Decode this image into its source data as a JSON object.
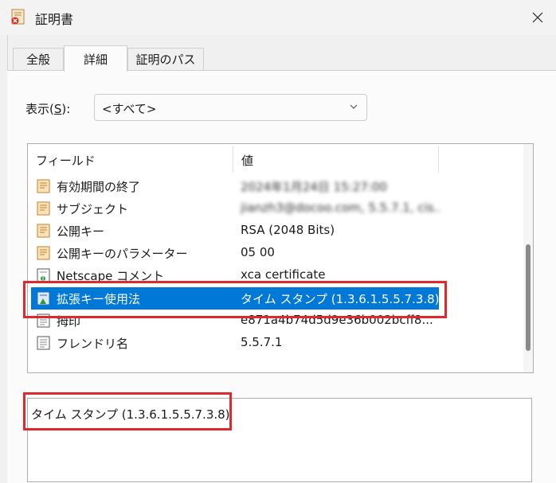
{
  "window": {
    "title": "証明書"
  },
  "tabs": [
    {
      "label": "全般"
    },
    {
      "label": "詳細"
    },
    {
      "label": "証明のパス"
    }
  ],
  "show": {
    "label_prefix": "表示(",
    "label_key": "S",
    "label_suffix": "):",
    "selected": "<すべて>"
  },
  "columns": {
    "field": "フィールド",
    "value": "値"
  },
  "rows": [
    {
      "field": "有効期間の終了",
      "value": "2024年1月24日 15:27:00",
      "icon": "certificate-field-icon"
    },
    {
      "field": "サブジェクト",
      "value": "jianzh3@docoo.com, 5.5.7.1, cis...",
      "icon": "certificate-field-icon"
    },
    {
      "field": "公開キー",
      "value": "RSA (2048 Bits)",
      "icon": "certificate-field-icon"
    },
    {
      "field": "公開キーのパラメーター",
      "value": "05 00",
      "icon": "certificate-field-icon"
    },
    {
      "field": "Netscape コメント",
      "value": "xca certificate",
      "icon": "certificate-extension-icon"
    },
    {
      "field": "拡張キー使用法",
      "value": "タイム スタンプ (1.3.6.1.5.5.7.3.8)",
      "icon": "certificate-extension-icon"
    },
    {
      "field": "拇印",
      "value": "e871a4b74d5d9e36b002bcff8...",
      "icon": "document-icon"
    },
    {
      "field": "フレンドリ名",
      "value": "5.5.7.1",
      "icon": "document-icon"
    }
  ],
  "detail_value": "タイム スタンプ (1.3.6.1.5.5.7.3.8)",
  "colors": {
    "selection": "#0078d7",
    "highlight": "#e0292d"
  }
}
